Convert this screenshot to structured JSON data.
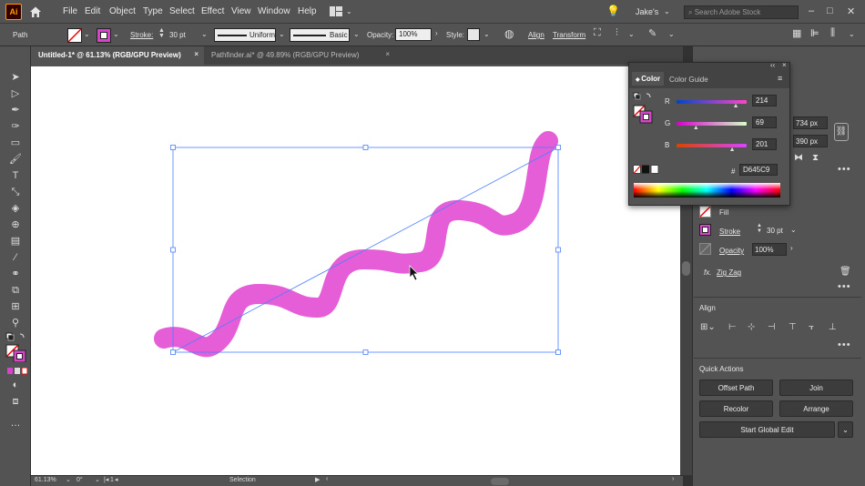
{
  "app": {
    "logo": "Ai"
  },
  "menu": [
    "File",
    "Edit",
    "Object",
    "Type",
    "Select",
    "Effect",
    "View",
    "Window",
    "Help"
  ],
  "user": {
    "name": "Jake's"
  },
  "search": {
    "placeholder": "Search Adobe Stock"
  },
  "control": {
    "selection_type": "Path",
    "stroke_label": "Stroke:",
    "stroke_value": "30 pt",
    "profile": "Uniform",
    "brush": "Basic",
    "opacity_label": "Opacity:",
    "opacity_value": "100%",
    "style_label": "Style:",
    "align_label": "Align",
    "transform_label": "Transform"
  },
  "tabs": [
    {
      "label": "Untitled-1* @ 61.13% (RGB/GPU Preview)",
      "close": "×"
    },
    {
      "label": "Pathfinder.ai* @ 49.89% (RGB/GPU Preview)",
      "close": "×"
    }
  ],
  "status": {
    "zoom": "61.13%",
    "angle": "0°",
    "artboard": "1",
    "tool": "Selection"
  },
  "color_panel": {
    "tab_color": "Color",
    "tab_guide": "Color Guide",
    "channels": [
      {
        "label": "R",
        "value": "214",
        "fraction": 0.839
      },
      {
        "label": "G",
        "value": "69",
        "fraction": 0.271
      },
      {
        "label": "B",
        "value": "201",
        "fraction": 0.788
      }
    ],
    "hash": "#",
    "hex": "D645C9"
  },
  "properties": {
    "width": "734 px",
    "height": "390 px",
    "fill_label": "Fill",
    "stroke_label": "Stroke",
    "stroke_value": "30 pt",
    "opacity_label": "Opacity",
    "opacity_value": "100%",
    "fx_label": "fx.",
    "effect_name": "Zig Zag",
    "align_title": "Align",
    "quick_actions_title": "Quick Actions",
    "buttons": {
      "offset_path": "Offset Path",
      "join": "Join",
      "recolor": "Recolor",
      "arrange": "Arrange",
      "global_edit": "Start Global Edit"
    }
  },
  "colors": {
    "stroke": "#D645C9",
    "wave": "#E55ED7",
    "selection": "#4a7eff"
  }
}
